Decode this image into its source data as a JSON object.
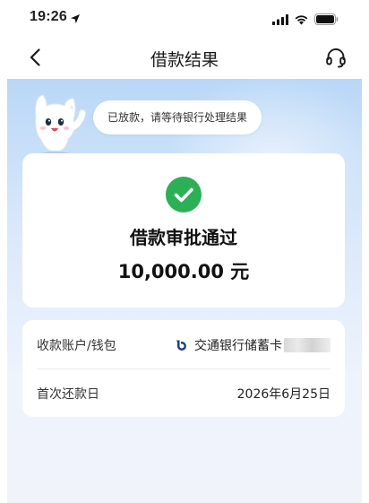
{
  "status_bar": {
    "time": "19:26",
    "icons": [
      "location-arrow-icon",
      "cellular-signal-icon",
      "wifi-icon",
      "battery-icon"
    ]
  },
  "nav": {
    "title": "借款结果",
    "back_icon": "chevron-left-icon",
    "support_icon": "headset-icon"
  },
  "notice": {
    "bubble_text": "已放款，请等待银行处理结果"
  },
  "result": {
    "status_icon": "check-circle-icon",
    "title": "借款审批通过",
    "amount": "10,000.00 元",
    "color": "#2bb055"
  },
  "details": {
    "rows": [
      {
        "label": "收款账户/钱包",
        "value": "交通银行储蓄卡",
        "icon": "bank-logo-icon"
      },
      {
        "label": "首次还款日",
        "value": "2026年6月25日"
      }
    ]
  }
}
